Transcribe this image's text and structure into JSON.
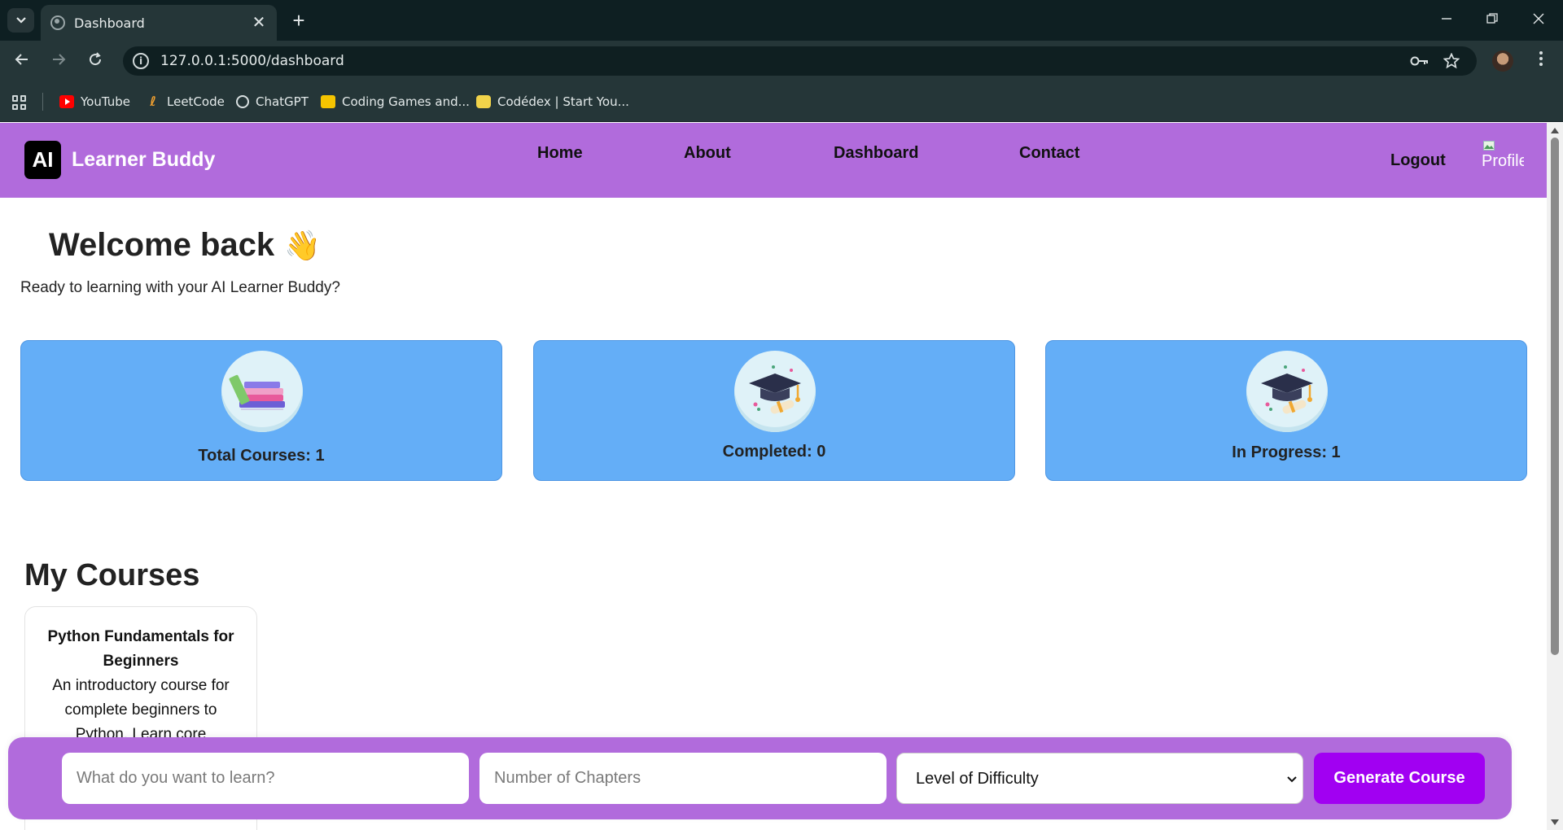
{
  "browser": {
    "tab_title": "Dashboard",
    "tab_close": "✕",
    "new_tab": "+",
    "url": "127.0.0.1:5000/dashboard",
    "bookmarks": [
      "YouTube",
      "LeetCode",
      "ChatGPT",
      "Coding Games and...",
      "Codédex | Start You..."
    ]
  },
  "navbar": {
    "logo_text": "AI",
    "brand": "Learner Buddy",
    "links": [
      "Home",
      "About",
      "Dashboard",
      "Contact"
    ],
    "logout": "Logout",
    "profile_alt": "Profile"
  },
  "welcome": {
    "heading": "Welcome back",
    "emoji": "👋",
    "subtitle": "Ready to learning with your AI Learner Buddy?"
  },
  "stats": [
    {
      "label": "Total Courses: 1",
      "icon": "books-icon"
    },
    {
      "label": "Completed: 0",
      "icon": "graduation-cap-icon"
    },
    {
      "label": "In Progress: 1",
      "icon": "graduation-cap-icon"
    }
  ],
  "courses": {
    "heading": "My Courses",
    "items": [
      {
        "title": "Python Fundamentals for Beginners",
        "description": "An introductory course for complete beginners to Python. Learn core"
      }
    ]
  },
  "generator": {
    "topic_placeholder": "What do you want to learn?",
    "chapters_placeholder": "Number of Chapters",
    "difficulty_value": "Level of Difficulty",
    "button_label": "Generate Course"
  },
  "colors": {
    "navbar": "#b16bdc",
    "stat_card": "#64aef7",
    "generate_button": "#a100f2"
  }
}
